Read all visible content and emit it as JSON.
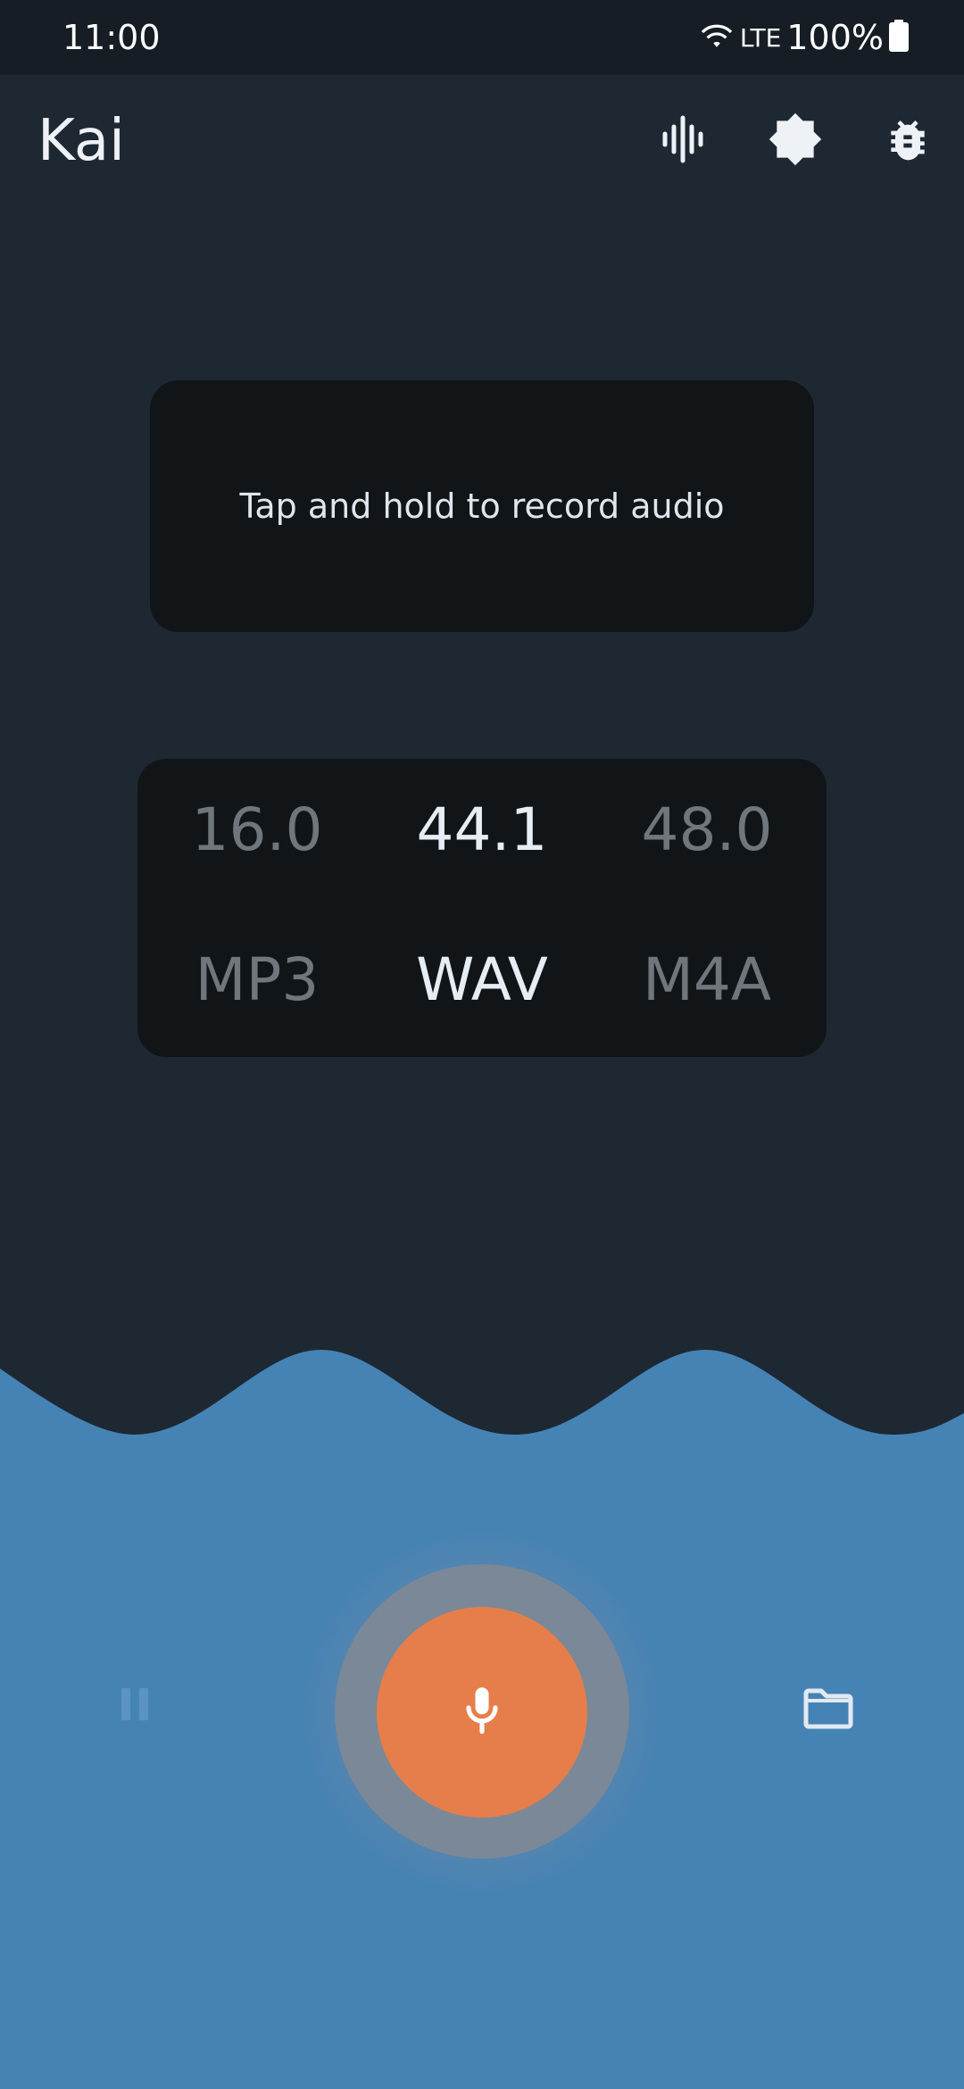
{
  "status_bar": {
    "time": "11:00",
    "network": "LTE",
    "battery": "100%"
  },
  "app_bar": {
    "title": "Kai",
    "actions": [
      "waveform-icon",
      "theme-toggle-icon",
      "bug-report-icon"
    ]
  },
  "hint": {
    "text": "Tap and hold to record audio"
  },
  "sample_rate": {
    "options": [
      "16.0",
      "44.1",
      "48.0"
    ],
    "selected": "44.1"
  },
  "format": {
    "options": [
      "MP3",
      "WAV",
      "M4A"
    ],
    "selected": "WAV"
  },
  "controls": {
    "pause_icon": "pause-icon",
    "record_icon": "microphone-icon",
    "folder_icon": "folder-icon"
  },
  "colors": {
    "background": "#1e2833",
    "wave": "#4683b5",
    "card": "#111517",
    "record_button": "#e67e4b",
    "record_ring": "#7b8897",
    "selected_text": "#e6edf4",
    "unselected_text": "#6f767c"
  }
}
